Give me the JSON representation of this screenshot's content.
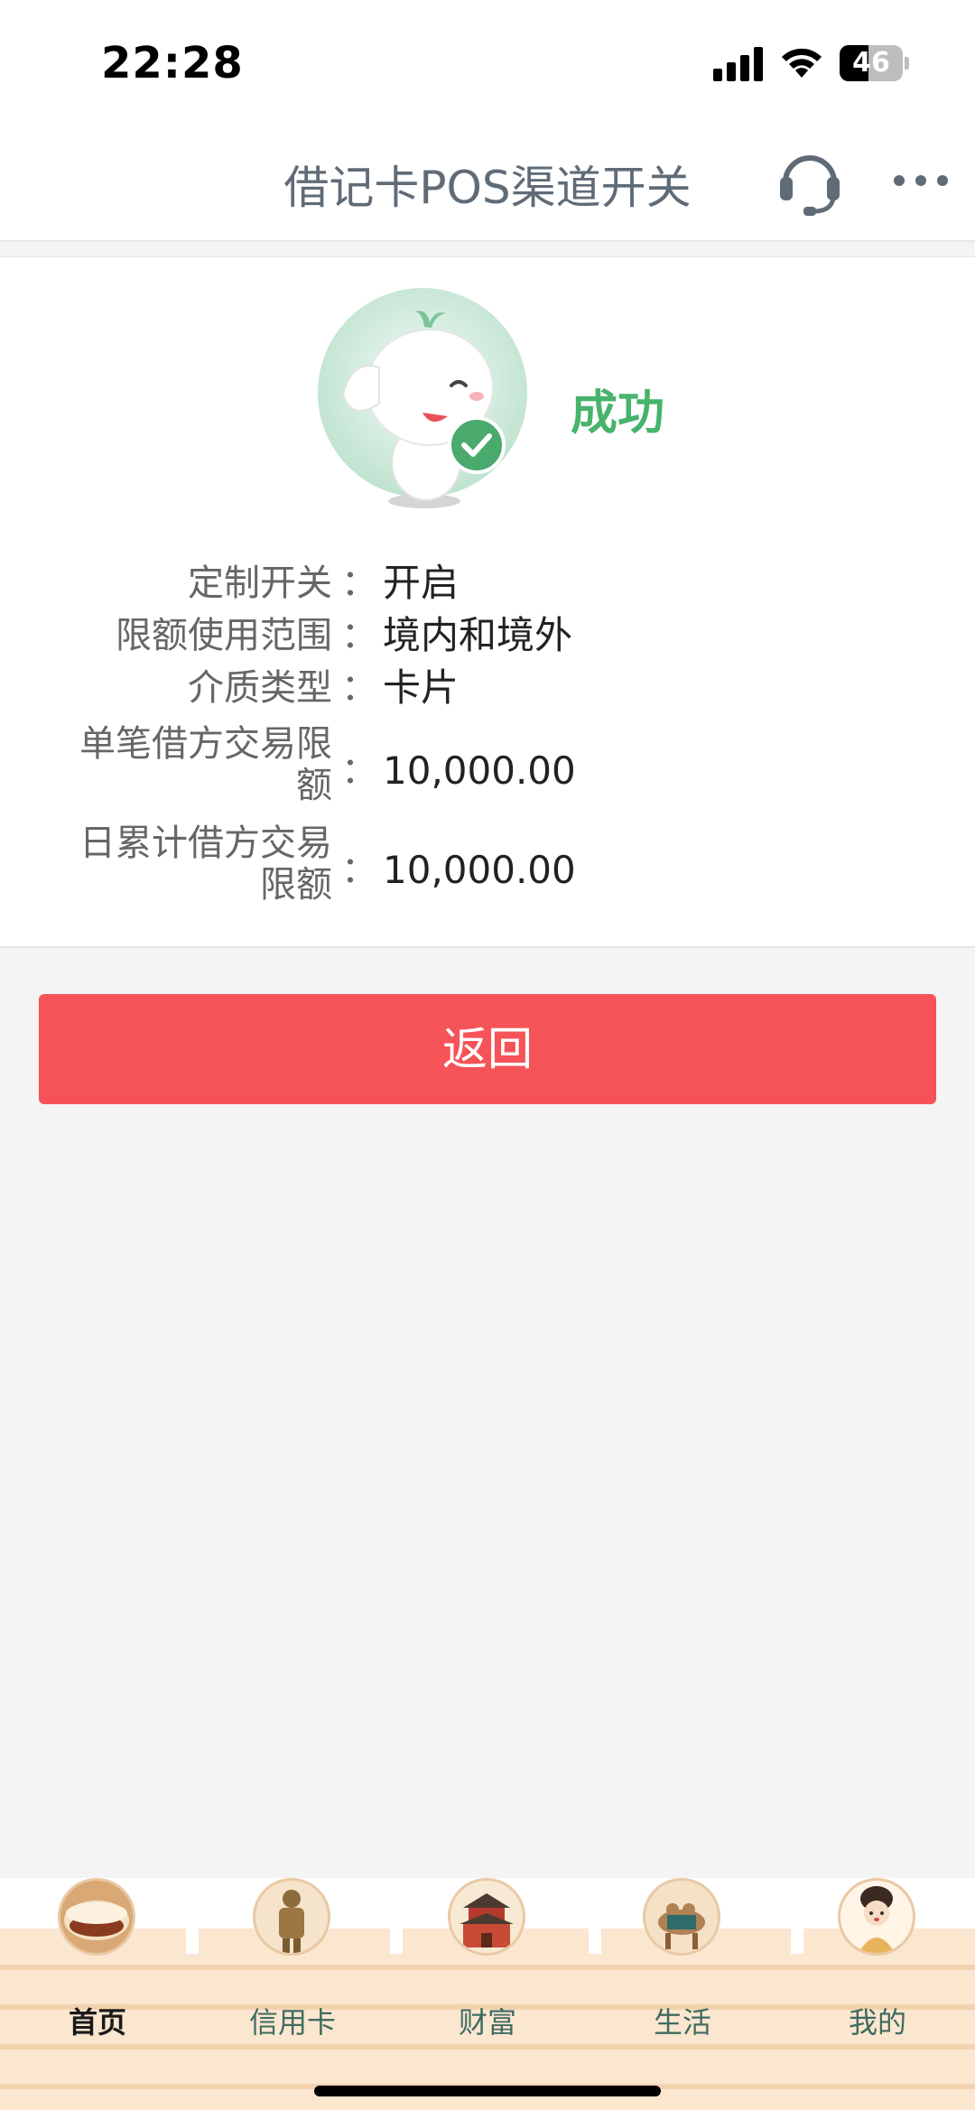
{
  "status_bar": {
    "time": "22:28",
    "battery": "46",
    "battery_level": 0.46
  },
  "nav": {
    "title": "借记卡POS渠道开关",
    "support_icon": "headset-icon",
    "more_icon": "more-dots-icon"
  },
  "result": {
    "status": "成功",
    "mascot_icon": "elephant-mascot-success-icon",
    "status_color": "#47b36b"
  },
  "details": [
    {
      "label": "定制开关",
      "colon": "：",
      "value": "开启"
    },
    {
      "label": "限额使用范围",
      "colon": "：",
      "value": "境内和境外"
    },
    {
      "label": "介质类型",
      "colon": "：",
      "value": "卡片"
    },
    {
      "label_line1": "单笔借方交易限",
      "label_line2": "额",
      "colon": "：",
      "value": "10,000.00"
    },
    {
      "label_line1": "日累计借方交易",
      "label_line2": "限额",
      "colon": "：",
      "value": "10,000.00"
    }
  ],
  "actions": {
    "return_label": "返回",
    "button_color": "#f65358"
  },
  "tabs": [
    {
      "label": "首页",
      "icon": "roujiamo-icon",
      "active": true
    },
    {
      "label": "信用卡",
      "icon": "terracotta-warrior-icon",
      "active": false
    },
    {
      "label": "财富",
      "icon": "bell-tower-icon",
      "active": false
    },
    {
      "label": "生活",
      "icon": "camel-icon",
      "active": false
    },
    {
      "label": "我的",
      "icon": "tang-lady-icon",
      "active": false
    }
  ]
}
